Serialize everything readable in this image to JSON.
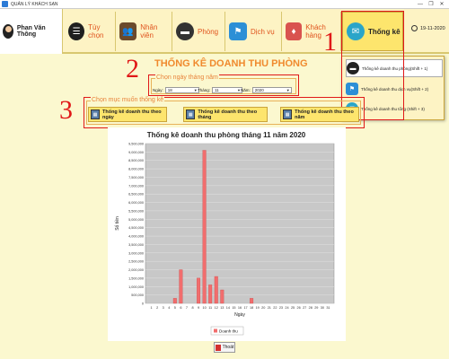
{
  "window": {
    "title": "QUẢN LÝ KHÁCH SẠN",
    "minimize": "—",
    "maximize": "❐",
    "close": "✕"
  },
  "user": {
    "name": "Phan Văn Thông"
  },
  "nav": {
    "items": [
      {
        "label": "Tùy chọn",
        "icon": "menu-list-icon",
        "color": "#1f1f1f"
      },
      {
        "label": "Nhân viên",
        "icon": "staff-icon",
        "color": "#6b4a2b"
      },
      {
        "label": "Phòng",
        "icon": "room-icon",
        "color": "#333333"
      },
      {
        "label": "Dịch vụ",
        "icon": "service-icon",
        "color": "#2c8fd6"
      },
      {
        "label": "Khách hàng",
        "icon": "customer-icon",
        "color": "#d9534f"
      },
      {
        "label": "Thống kê",
        "icon": "statistics-icon",
        "color": "#2aa5c9"
      }
    ],
    "date": "19-11-2020"
  },
  "dropdown": {
    "items": [
      {
        "label": "Thống kê doanh thu phòng(Shift + 1)",
        "icon": "room-revenue-icon"
      },
      {
        "label": "Thống kê doanh thu dịch vụ(Shift + 2)",
        "icon": "service-revenue-icon"
      },
      {
        "label": "Thống kê doanh thu tổng (Shift + 3)",
        "icon": "total-revenue-icon"
      }
    ]
  },
  "annotations": {
    "a1": "1",
    "a2": "2",
    "a3": "3"
  },
  "page": {
    "title": "THỐNG KÊ DOANH THU PHÒNG"
  },
  "date_picker": {
    "legend": "Chọn ngày tháng năm",
    "day_label": "Ngày:",
    "day_value": "18",
    "month_label": "Tháng:",
    "month_value": "11",
    "year_label": "Năm:",
    "year_value": "2020"
  },
  "stat_options": {
    "legend": "Chọn mục muốn thống kê",
    "buttons": [
      "Thống kê doanh thu theo ngày",
      "Thống kê doanh thu theo tháng",
      "Thống kê doanh thu theo năm"
    ]
  },
  "exit": {
    "label": "Thoát"
  },
  "chart_data": {
    "type": "bar",
    "title": "Thống kê doanh thu phòng tháng 11 năm 2020",
    "xlabel": "Ngày",
    "ylabel": "Số tiền",
    "categories": [
      "1",
      "2",
      "3",
      "4",
      "5",
      "6",
      "7",
      "8",
      "9",
      "10",
      "11",
      "12",
      "13",
      "14",
      "15",
      "16",
      "17",
      "18",
      "19",
      "20",
      "21",
      "22",
      "23",
      "24",
      "25",
      "26",
      "27",
      "28",
      "29",
      "30",
      "31"
    ],
    "series": [
      {
        "name": "Doanh thu",
        "color": "#f26d6d",
        "values": [
          0,
          0,
          0,
          0,
          300000,
          2000000,
          0,
          0,
          1500000,
          9100000,
          1100000,
          1600000,
          800000,
          0,
          0,
          0,
          0,
          300000,
          0,
          0,
          0,
          0,
          0,
          0,
          0,
          0,
          0,
          0,
          0,
          0,
          0
        ]
      }
    ],
    "ylim": [
      0,
      9500000
    ],
    "yticks": [
      "0",
      "500,000",
      "1,000,000",
      "1,500,000",
      "2,000,000",
      "2,500,000",
      "3,000,000",
      "3,500,000",
      "4,000,000",
      "4,500,000",
      "5,000,000",
      "5,500,000",
      "6,000,000",
      "6,500,000",
      "7,000,000",
      "7,500,000",
      "8,000,000",
      "8,500,000",
      "9,000,000",
      "9,500,000"
    ],
    "grid": true,
    "legend": "bottom"
  }
}
